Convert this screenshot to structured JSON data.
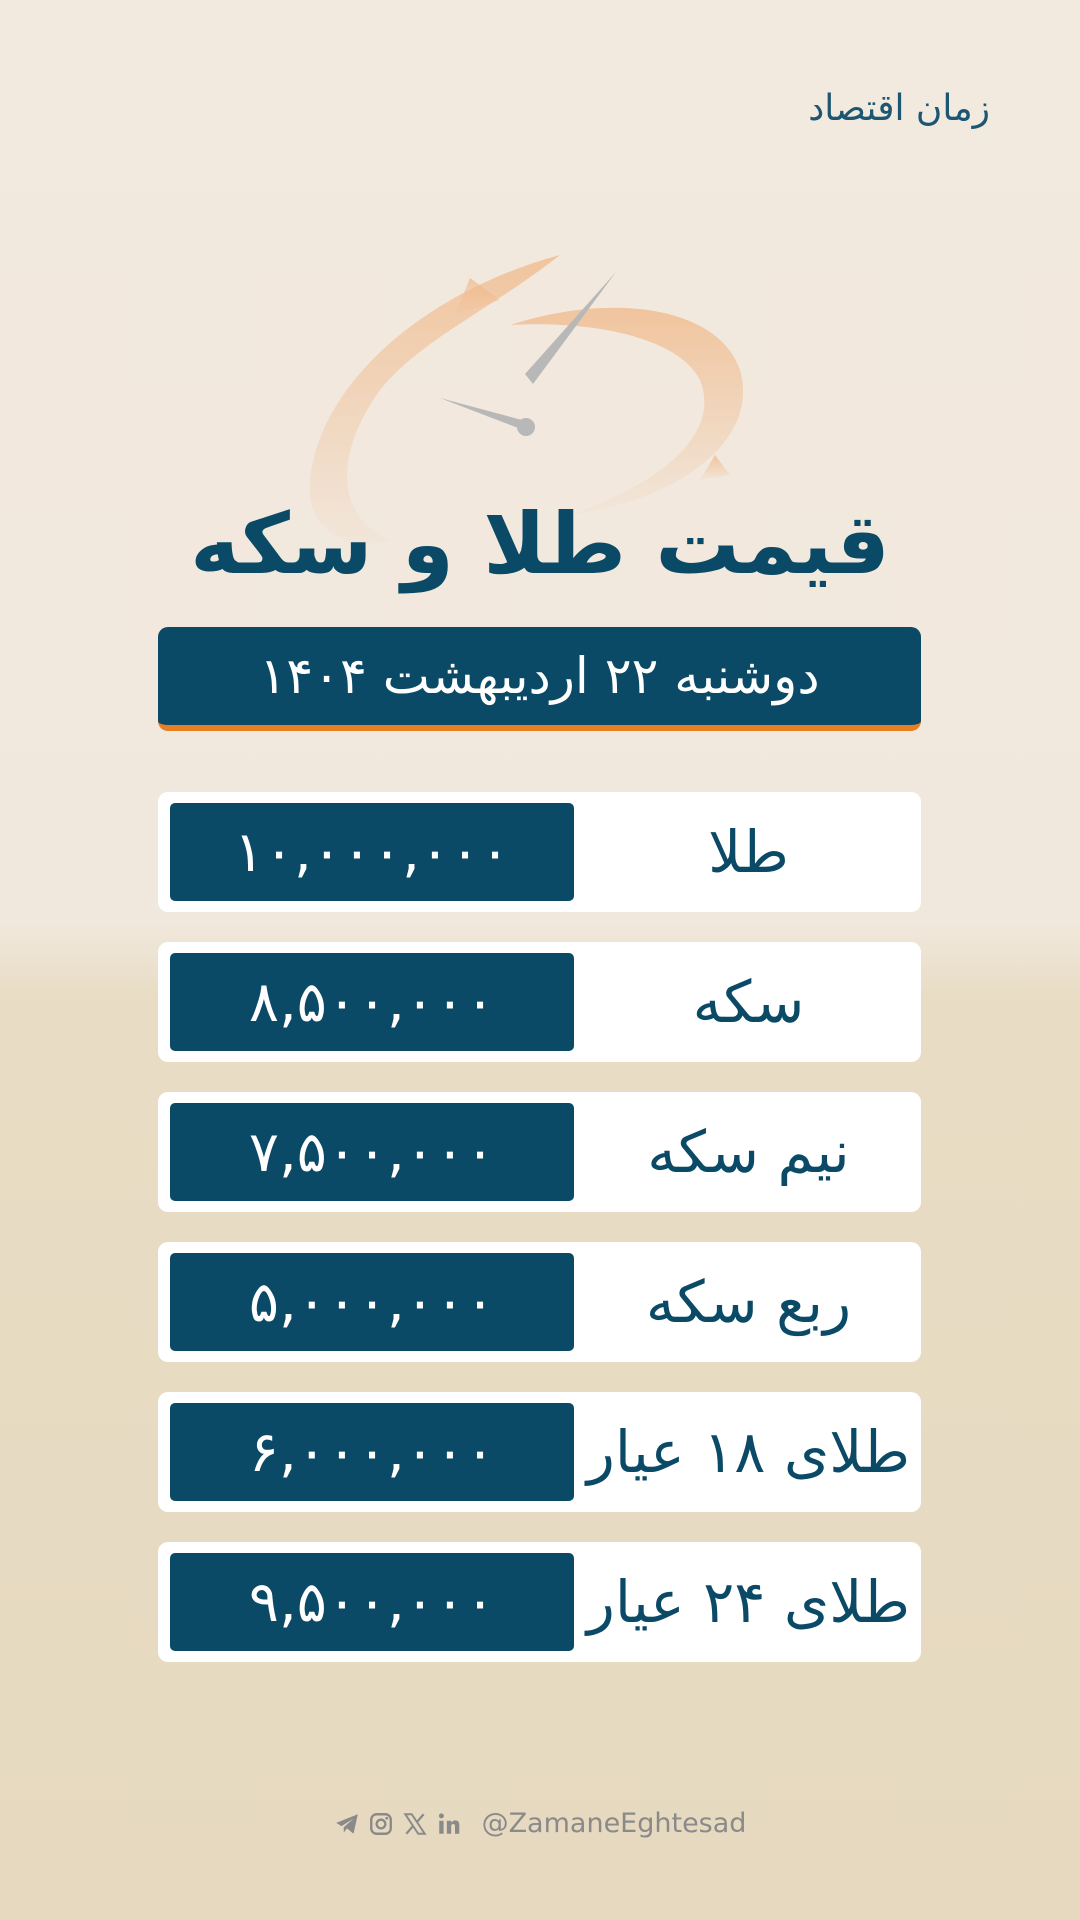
{
  "brand": {
    "name": "زمان اقتصاد"
  },
  "header": {
    "title": "قیمت طلا و سکه",
    "date": "دوشنبه ۲۲ اردیبهشت ۱۴۰۴"
  },
  "prices": [
    {
      "label": "طلا",
      "value": "۱۰,۰۰۰,۰۰۰"
    },
    {
      "label": "سکه",
      "value": "۸,۵۰۰,۰۰۰"
    },
    {
      "label": "نیم سکه",
      "value": "۷,۵۰۰,۰۰۰"
    },
    {
      "label": "ربع سکه",
      "value": "۵,۰۰۰,۰۰۰"
    },
    {
      "label": "طلای ۱۸ عیار",
      "value": "۶,۰۰۰,۰۰۰"
    },
    {
      "label": "طلای ۲۴ عیار",
      "value": "۹,۵۰۰,۰۰۰"
    }
  ],
  "footer": {
    "icons": [
      "telegram-icon",
      "instagram-icon",
      "x-icon",
      "linkedin-icon"
    ],
    "handle": "@ZamaneEghtesad"
  },
  "colors": {
    "primary": "#0b4a66",
    "accent": "#e67e22",
    "background_top": "#f2e9df",
    "background_bottom": "#e6d9c0"
  }
}
